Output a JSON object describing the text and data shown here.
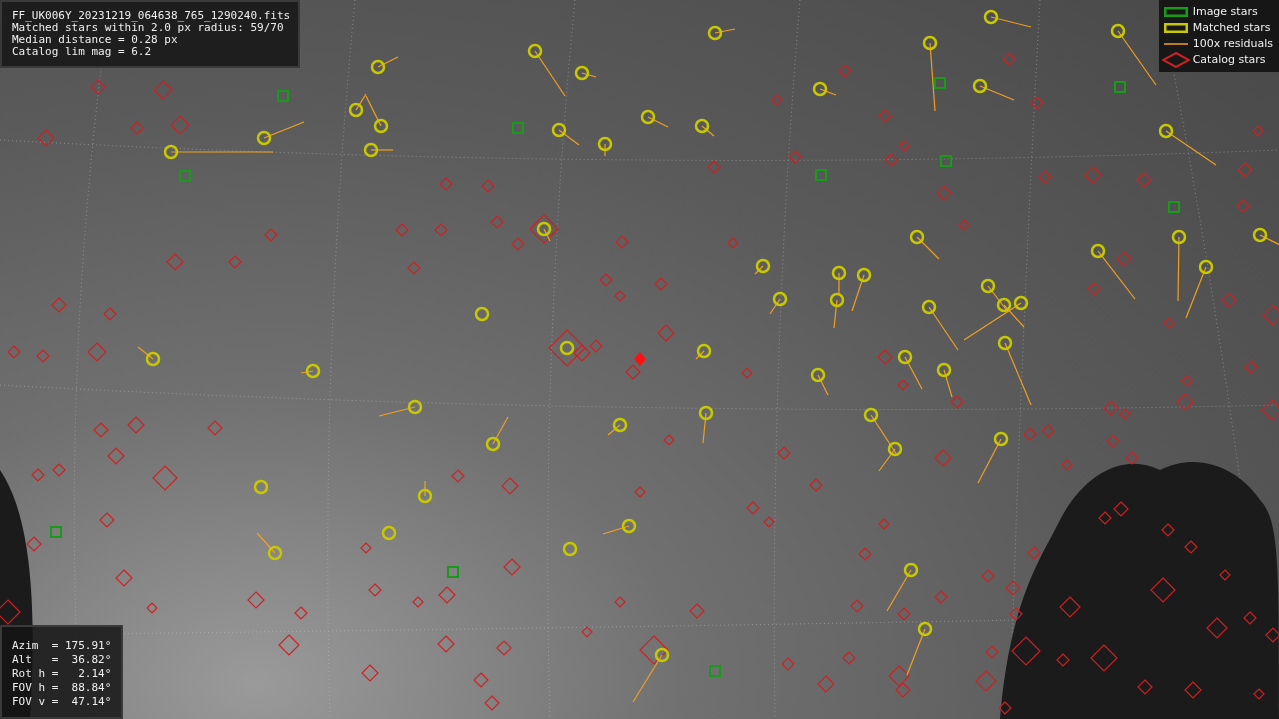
{
  "info_panel": {
    "lines": [
      "FF_UK006Y_20231219_064638_765_1290240.fits",
      "Matched stars within 2.0 px radius: 59/70",
      "Median distance = 0.28 px",
      "Catalog lim mag = 6.2"
    ]
  },
  "legend": [
    {
      "kind": "image",
      "label": "Image stars"
    },
    {
      "kind": "matched",
      "label": "Matched stars"
    },
    {
      "kind": "residual",
      "label": "100x residuals"
    },
    {
      "kind": "catalog",
      "label": "Catalog stars"
    }
  ],
  "pointing_panel": {
    "lines": [
      "Azim  = 175.91°",
      "Alt   =  36.82°",
      "Rot h =   2.14°",
      "FOV h =  88.84°",
      "FOV v =  47.14°"
    ]
  }
}
